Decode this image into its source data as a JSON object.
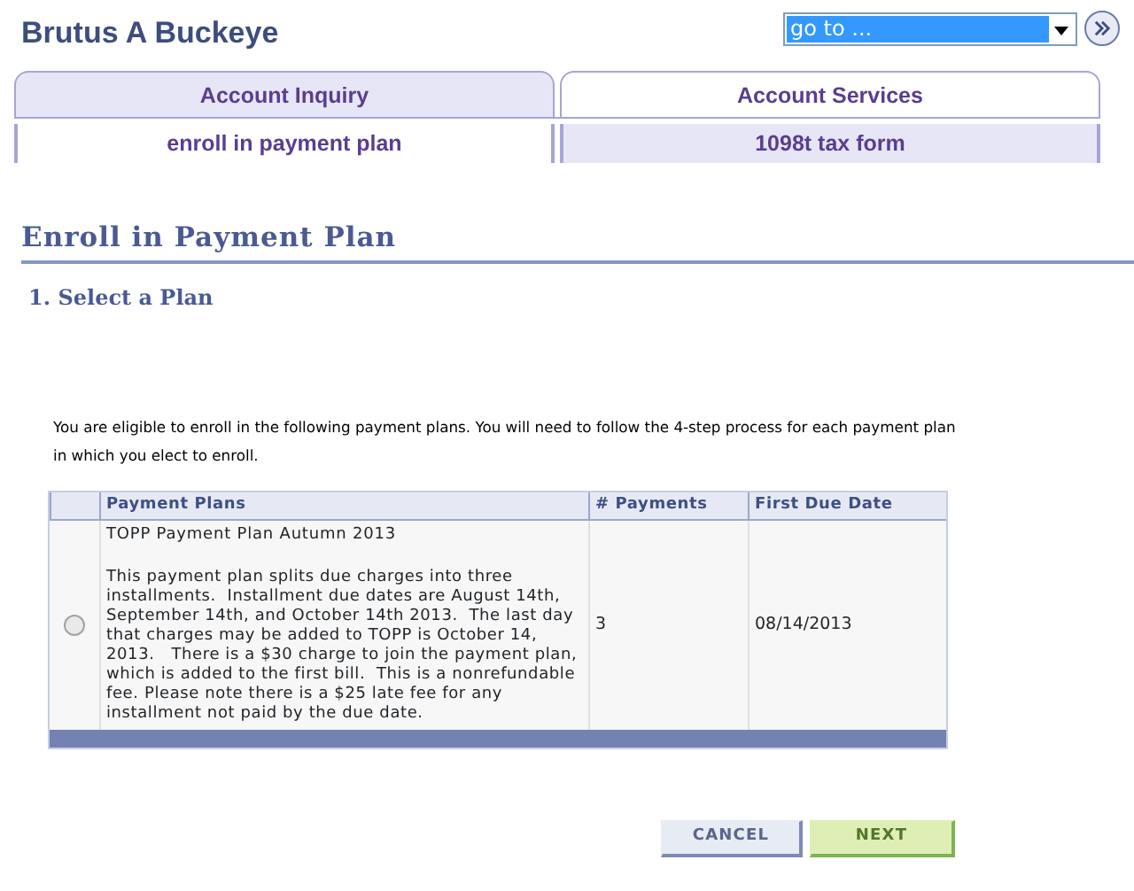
{
  "header": {
    "name": "Brutus A Buckeye",
    "goto": {
      "value": "go to ..."
    }
  },
  "tabs": [
    {
      "label": "Account Inquiry",
      "selected": false
    },
    {
      "label": "Account Services",
      "selected": true
    }
  ],
  "subtabs": [
    {
      "label": "enroll in payment plan",
      "selected": true
    },
    {
      "label": "1098t tax form",
      "selected": false
    }
  ],
  "page_title": "Enroll in Payment Plan",
  "step_title": "1. Select a Plan",
  "intro": "You are eligible to enroll in the following payment plans. You will need to follow the 4-step process for each payment plan in which you elect to enroll.",
  "table": {
    "columns": [
      "Payment Plans",
      "# Payments",
      "First Due Date"
    ],
    "rows": [
      {
        "selected": false,
        "plan_name": "TOPP Payment Plan Autumn 2013",
        "description": "This payment plan splits due charges into three installments.  Installment due dates are August 14th, September 14th, and October 14th 2013.  The last day that charges may be added to TOPP is October 14, 2013.   There is a $30 charge to join the payment plan, which is added to the first bill.  This is a nonrefundable fee. Please note there is a $25 late fee for any installment not paid by the due date.",
        "payments": "3",
        "first_due_date": "08/14/2013"
      }
    ]
  },
  "buttons": [
    {
      "label": "CANCEL",
      "kind": "secondary"
    },
    {
      "label": "NEXT",
      "kind": "primary"
    }
  ]
}
